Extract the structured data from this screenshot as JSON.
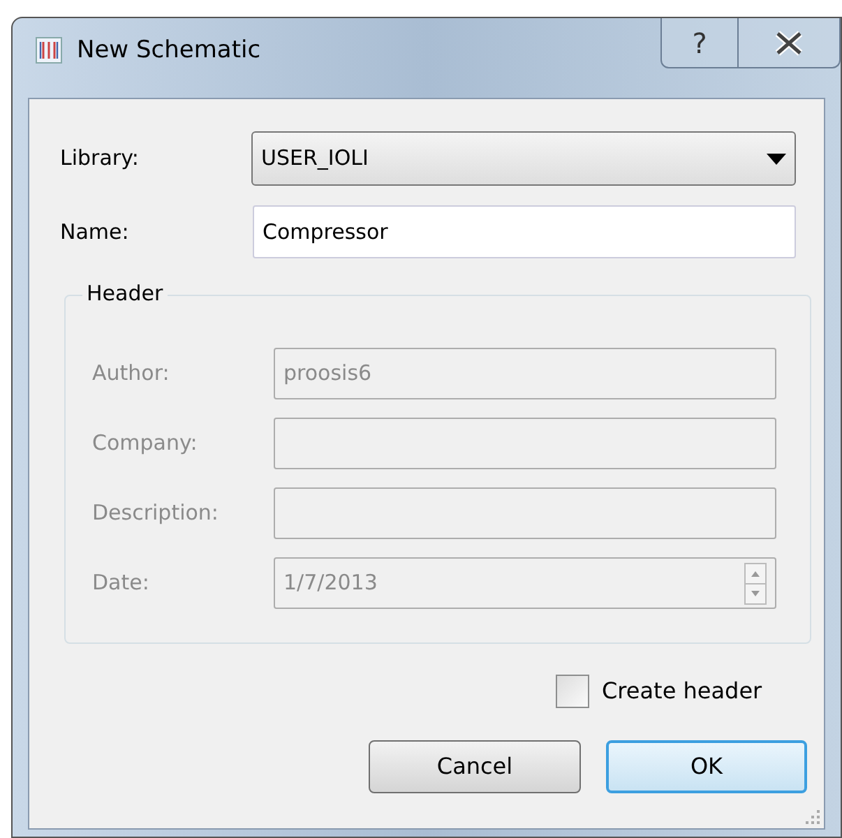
{
  "window": {
    "title": "New Schematic",
    "controls": [
      "?"
    ]
  },
  "library": {
    "label": "Library:",
    "value": "USER_IOLI"
  },
  "name": {
    "label": "Name:",
    "value": "Compressor"
  },
  "header": {
    "title": "Header",
    "disabled": true,
    "fields": [
      {
        "label": "Author:",
        "value": "proosis6",
        "kind": "text"
      },
      {
        "label": "Company:",
        "kind": "text"
      },
      {
        "label": "Description:",
        "kind": "text"
      },
      {
        "label": "Date:",
        "value": "1/7/2013",
        "kind": "date"
      }
    ]
  },
  "create_header": {
    "label": "Create header",
    "checked": false
  },
  "buttons": [
    {
      "label": "Cancel",
      "default": false
    },
    {
      "label": "OK",
      "default": true
    }
  ]
}
